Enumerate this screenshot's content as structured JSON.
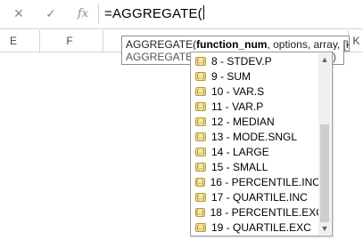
{
  "formula_bar": {
    "cancel_icon": "close-icon",
    "enter_icon": "check-icon",
    "fx_label": "fx",
    "formula": "=AGGREGATE("
  },
  "columns": [
    "E",
    "F",
    "K"
  ],
  "tooltip": {
    "func_name": "AGGREGATE(",
    "bold_arg": "function_num",
    "rest": ", options, array, [k])",
    "line2_start": "AGGREGATE(",
    "line2_end": ")"
  },
  "dropdown": {
    "items": [
      "8 - STDEV.P",
      "9 - SUM",
      "10 - VAR.S",
      "11 - VAR.P",
      "12 - MEDIAN",
      "13 - MODE.SNGL",
      "14 - LARGE",
      "15 - SMALL",
      "16 - PERCENTILE.INC",
      "17 - QUARTILE.INC",
      "18 - PERCENTILE.EXC",
      "19 - QUARTILE.EXC"
    ]
  }
}
